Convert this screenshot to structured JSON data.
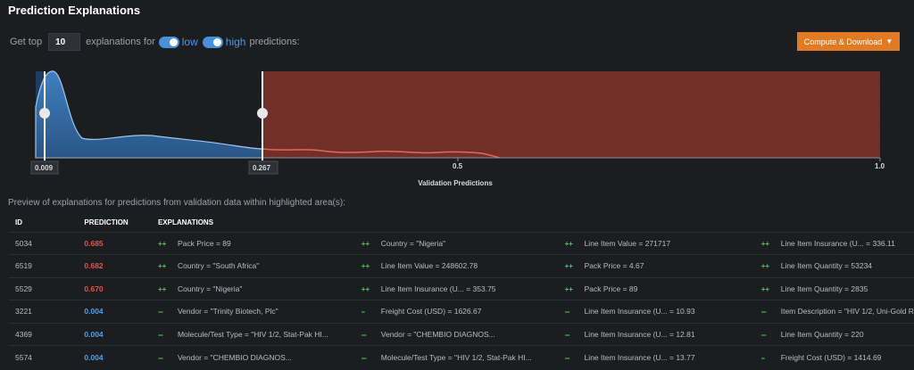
{
  "title": "Prediction Explanations",
  "controls": {
    "prefix": "Get top",
    "count": "10",
    "mid": "explanations for",
    "low_label": "low",
    "high_label": "high",
    "suffix": "predictions:"
  },
  "compute_button": "Compute & Download",
  "chart": {
    "xlabel": "Validation Predictions",
    "ticks": [
      "0.5",
      "1.0"
    ],
    "handle_low": "0.009",
    "handle_high": "0.267",
    "low_threshold": 0.009,
    "high_threshold": 0.267,
    "colors": {
      "low": "#4a8fd0",
      "high": "#7d2e29"
    }
  },
  "preview_text": "Preview of explanations for predictions from validation data within highlighted area(s):",
  "table": {
    "headers": {
      "id": "ID",
      "prediction": "PREDICTION",
      "explanations": "EXPLANATIONS"
    },
    "rows": [
      {
        "id": "5034",
        "prediction": "0.685",
        "kind": "high",
        "e": [
          {
            "s": "++",
            "t": "Pack Price = 89"
          },
          {
            "s": "++",
            "t": "Country = \"Nigeria\""
          },
          {
            "s": "++",
            "t": "Line Item Value = 271717"
          },
          {
            "s": "++",
            "t": "Line Item Insurance (U... = 336.11"
          }
        ]
      },
      {
        "id": "6519",
        "prediction": "0.682",
        "kind": "high",
        "e": [
          {
            "s": "++",
            "t": "Country = \"South Africa\""
          },
          {
            "s": "++",
            "t": "Line Item Value = 248602.78"
          },
          {
            "s": "++",
            "t": "Pack Price = 4.67"
          },
          {
            "s": "++",
            "t": "Line Item Quantity = 53234"
          }
        ]
      },
      {
        "id": "5529",
        "prediction": "0.670",
        "kind": "high",
        "e": [
          {
            "s": "++",
            "t": "Country = \"Nigeria\""
          },
          {
            "s": "++",
            "t": "Line Item Insurance (U... = 353.75"
          },
          {
            "s": "++",
            "t": "Pack Price = 89"
          },
          {
            "s": "++",
            "t": "Line Item Quantity = 2835"
          }
        ]
      },
      {
        "id": "3221",
        "prediction": "0.004",
        "kind": "low",
        "e": [
          {
            "s": "---",
            "t": "Vendor = \"Trinity Biotech, Plc\""
          },
          {
            "s": "--",
            "t": "Freight Cost (USD) = 1626.67"
          },
          {
            "s": "---",
            "t": "Line Item Insurance (U... = 10.93"
          },
          {
            "s": "---",
            "t": "Item Description = \"HIV 1/2, Uni-Gold R"
          }
        ]
      },
      {
        "id": "4369",
        "prediction": "0.004",
        "kind": "low",
        "e": [
          {
            "s": "---",
            "t": "Molecule/Test Type = \"HIV 1/2, Stat-Pak HI..."
          },
          {
            "s": "---",
            "t": "Vendor = \"CHEMBIO DIAGNOS..."
          },
          {
            "s": "---",
            "t": "Line Item Insurance (U... = 12.81"
          },
          {
            "s": "---",
            "t": "Line Item Quantity = 220"
          }
        ]
      },
      {
        "id": "5574",
        "prediction": "0.004",
        "kind": "low",
        "e": [
          {
            "s": "---",
            "t": "Vendor = \"CHEMBIO DIAGNOS..."
          },
          {
            "s": "---",
            "t": "Molecule/Test Type = \"HIV 1/2, Stat-Pak HI..."
          },
          {
            "s": "---",
            "t": "Line Item Insurance (U... = 13.77"
          },
          {
            "s": "--",
            "t": "Freight Cost (USD) = 1414.69"
          }
        ]
      }
    ]
  }
}
